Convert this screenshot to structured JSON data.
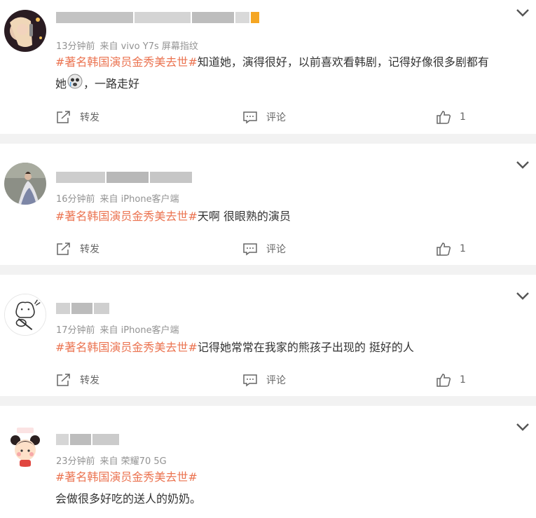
{
  "comments": [
    {
      "time": "13分钟前",
      "source": "来自 vivo Y7s 屏幕指纹",
      "hashtag": "#著名韩国演员金秀美去世#",
      "text": "知道她，演得很好，以前喜欢看韩剧，记得好像很多剧都有",
      "text2": "她",
      "emoji": "crying-emoji",
      "text_after": "，一路走好",
      "repost_label": "转发",
      "comment_label": "评论",
      "like_count": "1"
    },
    {
      "time": "16分钟前",
      "source": "来自 iPhone客户端",
      "hashtag": "#著名韩国演员金秀美去世#",
      "text": "天啊 很眼熟的演员",
      "repost_label": "转发",
      "comment_label": "评论",
      "like_count": "1"
    },
    {
      "time": "17分钟前",
      "source": "来自 iPhone客户端",
      "hashtag": "#著名韩国演员金秀美去世#",
      "text": "记得她常常在我家的熊孩子出现的 挺好的人",
      "repost_label": "转发",
      "comment_label": "评论",
      "like_count": "1"
    },
    {
      "time": "23分钟前",
      "source": "来自 荣耀70 5G",
      "hashtag": "#著名韩国演员金秀美去世#",
      "text": "会做很多好吃的送人的奶奶。"
    }
  ],
  "colors": {
    "hashtag": "#eb7350",
    "meta": "#939393",
    "background": "#f2f2f2"
  }
}
